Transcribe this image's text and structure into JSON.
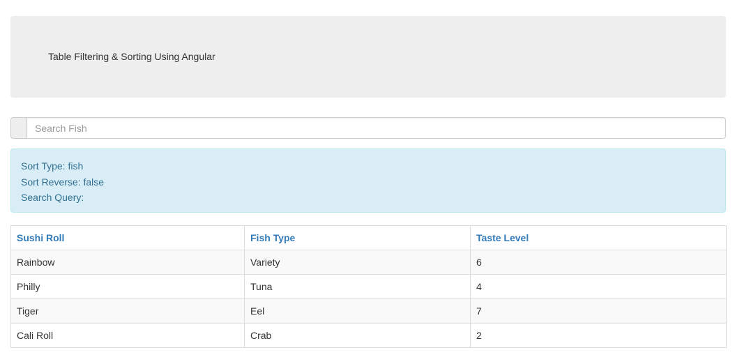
{
  "header": {
    "title": "Table Filtering & Sorting Using Angular"
  },
  "search": {
    "placeholder": "Search Fish",
    "value": ""
  },
  "info": {
    "sort_type_label": "Sort Type:",
    "sort_type_value": "fish",
    "sort_reverse_label": "Sort Reverse:",
    "sort_reverse_value": "false",
    "search_query_label": "Search Query:",
    "search_query_value": ""
  },
  "table": {
    "columns": [
      "Sushi Roll",
      "Fish Type",
      "Taste Level"
    ],
    "rows": [
      [
        "Rainbow",
        "Variety",
        "6"
      ],
      [
        "Philly",
        "Tuna",
        "4"
      ],
      [
        "Tiger",
        "Eel",
        "7"
      ],
      [
        "Cali Roll",
        "Crab",
        "2"
      ]
    ]
  },
  "colors": {
    "accent": "#337ab7",
    "info_bg": "#d9edf7",
    "info_text": "#31708f",
    "jumbotron_bg": "#eeeeee"
  }
}
